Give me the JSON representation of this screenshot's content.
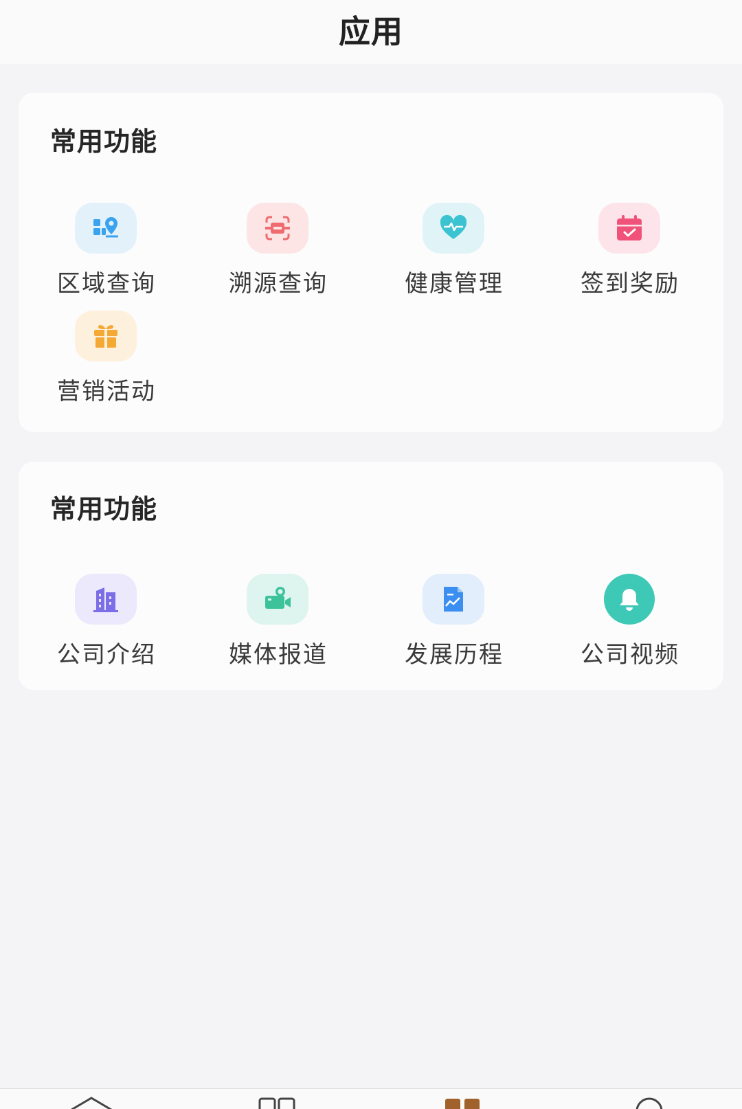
{
  "header": {
    "title": "应用"
  },
  "sections": [
    {
      "title": "常用功能",
      "items": [
        {
          "label": "区域查询",
          "icon": "map-location-icon",
          "bg": "#e3f1fb",
          "color": "#3aa3f0"
        },
        {
          "label": "溯源查询",
          "icon": "scan-icon",
          "bg": "#fde5e6",
          "color": "#ee6b6f"
        },
        {
          "label": "健康管理",
          "icon": "heart-pulse-icon",
          "bg": "#e0f4f7",
          "color": "#3cc3d1"
        },
        {
          "label": "签到奖励",
          "icon": "calendar-check-icon",
          "bg": "#fde4ea",
          "color": "#f0527a"
        },
        {
          "label": "营销活动",
          "icon": "gift-icon",
          "bg": "#fdf0dd",
          "color": "#f5a935"
        }
      ]
    },
    {
      "title": "常用功能",
      "items": [
        {
          "label": "公司介绍",
          "icon": "building-icon",
          "bg": "#ebe9fb",
          "color": "#7b6ee6"
        },
        {
          "label": "媒体报道",
          "icon": "video-camera-icon",
          "bg": "#def4ee",
          "color": "#3cc39a"
        },
        {
          "label": "发展历程",
          "icon": "chart-document-icon",
          "bg": "#e2eefb",
          "color": "#3a8ff0"
        },
        {
          "label": "公司视频",
          "icon": "bell-icon",
          "bg": "#3dc9b6",
          "color": "#ffffff"
        }
      ]
    }
  ],
  "tabbar": {
    "tabs": [
      {
        "icon": "home-icon",
        "active": false
      },
      {
        "icon": "grid-icon",
        "active": false
      },
      {
        "icon": "apps-icon",
        "active": true
      },
      {
        "icon": "profile-icon",
        "active": false
      }
    ],
    "active_color": "#a0622a",
    "inactive_color": "#444444"
  }
}
